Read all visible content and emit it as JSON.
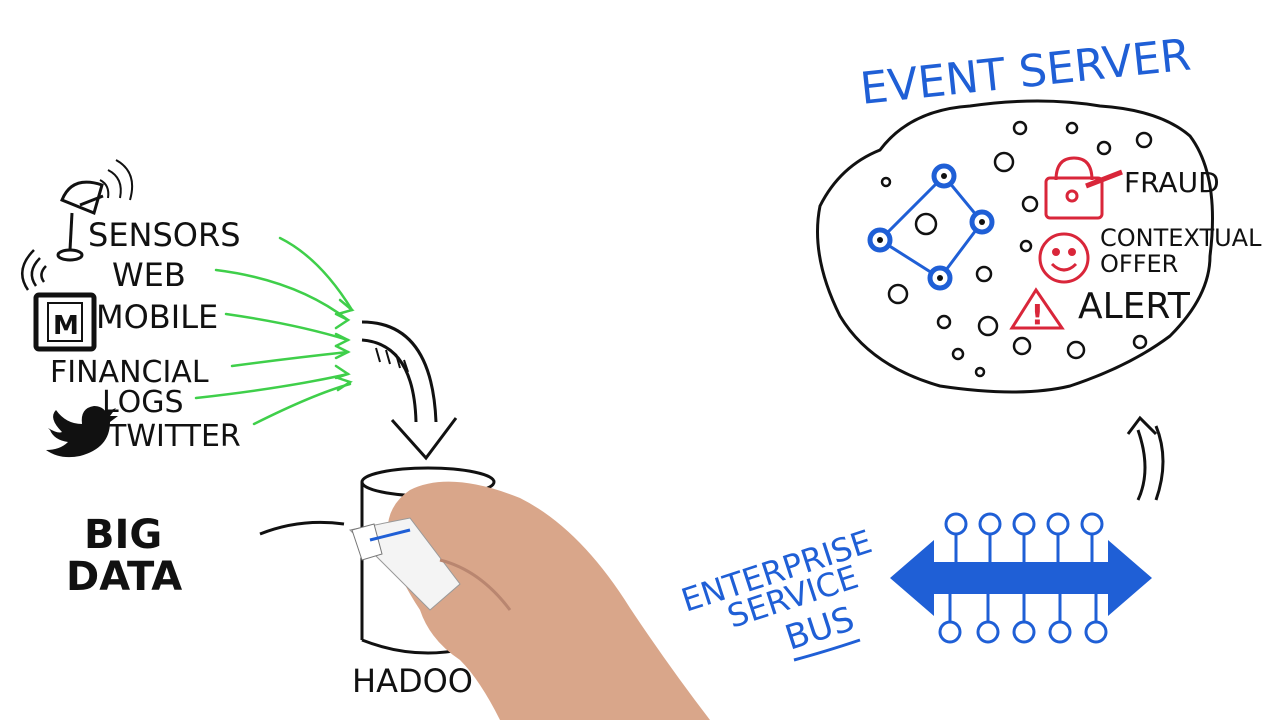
{
  "sources": {
    "items": [
      "SENSORS",
      "WEB",
      "MOBILE",
      "FINANCIAL",
      "LOGS",
      "TWITTER"
    ],
    "mobile_badge": "M"
  },
  "big_data": {
    "line1": "BIG",
    "line2": "DATA"
  },
  "storage": {
    "label": "HADOOP",
    "visible_label": "HADOO"
  },
  "event_server": {
    "title": "EVENT SERVER",
    "outputs": {
      "fraud": "FRAUD",
      "offer_line1": "CONTEXTUAL",
      "offer_line2": "OFFER",
      "alert": "ALERT"
    },
    "alert_symbol": "!"
  },
  "esb": {
    "line1": "ENTERPRISE",
    "line2": "SERVICE",
    "line3": "BUS"
  },
  "colors": {
    "ink": "#111111",
    "blue": "#1f5fd6",
    "green": "#3fcf4a",
    "red": "#d9263a",
    "skin": "#d9a68a"
  },
  "icons": [
    "satellite-dish-icon",
    "wifi-icon",
    "mobile-phone-icon",
    "twitter-bird-icon",
    "padlock-icon",
    "smiley-icon",
    "warning-icon",
    "drawing-hand"
  ]
}
